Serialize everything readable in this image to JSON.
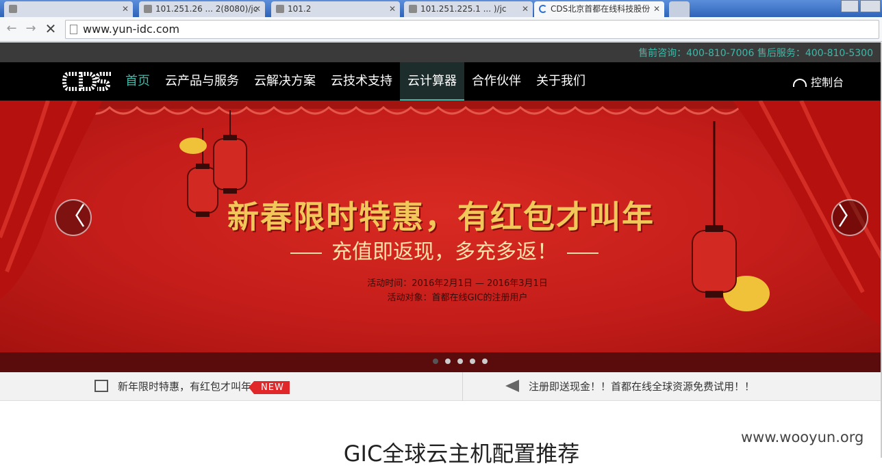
{
  "browser": {
    "tabs": [
      {
        "title": ""
      },
      {
        "title": "101.251.26 ... 2(8080)/jc"
      },
      {
        "title": "101.2"
      },
      {
        "title": "101.251.225.1 ... )/jc"
      },
      {
        "title": "CDS北京首都在线科技股份"
      }
    ],
    "url": "www.yun-idc.com"
  },
  "site": {
    "hotline": "售前咨询：400-810-7006 售后服务：400-810-5300",
    "menu": [
      "首页",
      "云产品与服务",
      "云解决方案",
      "云技术支持",
      "云计算器",
      "合作伙伴",
      "关于我们"
    ],
    "console": "控制台",
    "banner": {
      "headline": "新春限时特惠，有红包才叫年",
      "sub": "充值即返现，多充多返！",
      "time": "活动时间：2016年2月1日 — 2016年3月1日",
      "target": "活动对象：首都在线GIC的注册用户",
      "prev": "〈",
      "next": "〉"
    },
    "news": {
      "left": "新年限时特惠，有红包才叫年",
      "tag": "NEW",
      "right": "注册即送现金！！首都在线全球资源免费试用！！"
    },
    "section_title": "GIC全球云主机配置推荐"
  },
  "watermark": "www.wooyun.org"
}
